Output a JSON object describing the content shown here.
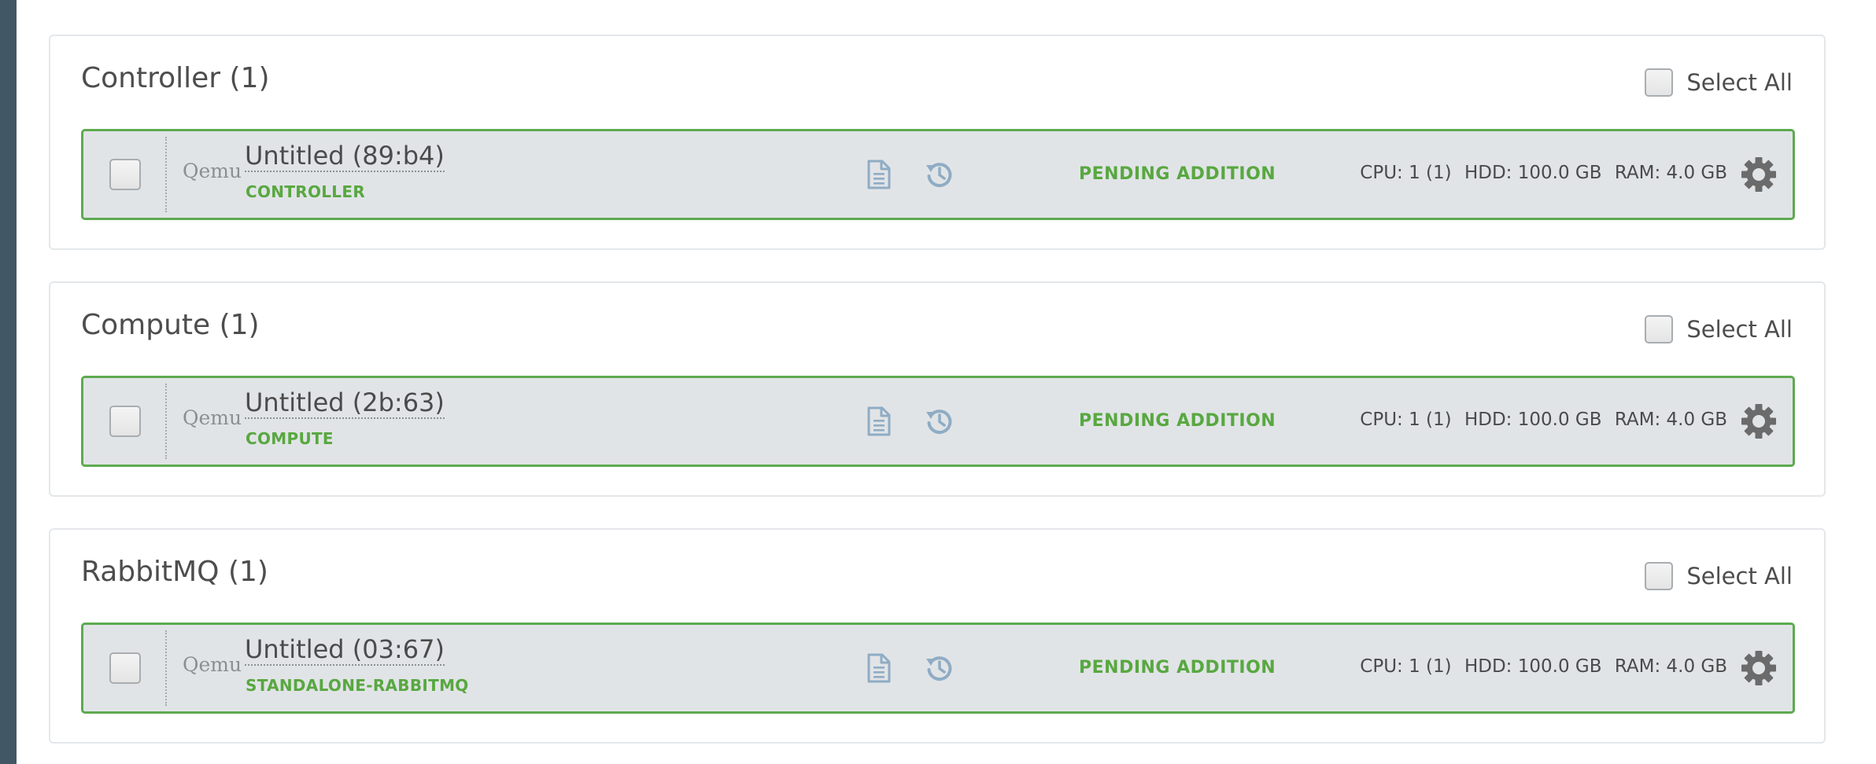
{
  "groups": [
    {
      "title": "Controller (1)",
      "select_all_label": "Select All",
      "nodes": [
        {
          "manufacturer": "Qemu",
          "name": "Untitled (89:b4)",
          "role": "CONTROLLER",
          "status": "PENDING ADDITION",
          "cpu": "CPU: 1 (1)",
          "hdd": "HDD: 100.0 GB",
          "ram": "RAM: 4.0 GB"
        }
      ]
    },
    {
      "title": "Compute (1)",
      "select_all_label": "Select All",
      "nodes": [
        {
          "manufacturer": "Qemu",
          "name": "Untitled (2b:63)",
          "role": "COMPUTE",
          "status": "PENDING ADDITION",
          "cpu": "CPU: 1 (1)",
          "hdd": "HDD: 100.0 GB",
          "ram": "RAM: 4.0 GB"
        }
      ]
    },
    {
      "title": "RabbitMQ (1)",
      "select_all_label": "Select All",
      "nodes": [
        {
          "manufacturer": "Qemu",
          "name": "Untitled (03:67)",
          "role": "STANDALONE-RABBITMQ",
          "status": "PENDING ADDITION",
          "cpu": "CPU: 1 (1)",
          "hdd": "HDD: 100.0 GB",
          "ram": "RAM: 4.0 GB"
        }
      ]
    }
  ],
  "icons": {
    "logs": "file-text-icon",
    "history": "history-icon",
    "settings": "gear-icon"
  },
  "colors": {
    "background": "#415766",
    "status_green": "#58a840",
    "node_border": "#5daa4f",
    "node_background": "#e1e4e7",
    "icon_blue": "#8facc4",
    "gear_gray": "#6b6b6b"
  }
}
